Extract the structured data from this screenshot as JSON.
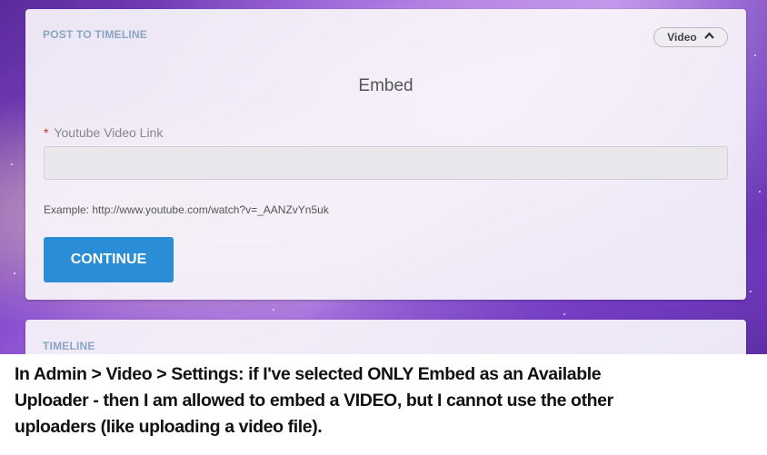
{
  "post_card": {
    "title": "POST TO TIMELINE",
    "type_selector": {
      "label": "Video"
    },
    "heading": "Embed",
    "field": {
      "required_mark": "*",
      "label": "Youtube Video Link",
      "value": ""
    },
    "example_text": "Example: http://www.youtube.com/watch?v=_AANZvYn5uk",
    "continue_label": "CONTINUE"
  },
  "timeline_card": {
    "title": "TIMELINE"
  },
  "caption": {
    "line1": "In Admin > Video > Settings:    if I've selected ONLY Embed  as an Available",
    "line2": "Uploader - then I am allowed to embed  a VIDEO, but I cannot use the other",
    "line3": "uploaders (like uploading a video file)."
  },
  "colors": {
    "accent": "#2b8dd6",
    "card_title": "#8aa6c1",
    "required": "#c0392b"
  },
  "icons": {
    "selector_chevron": "chevron-up-icon"
  }
}
